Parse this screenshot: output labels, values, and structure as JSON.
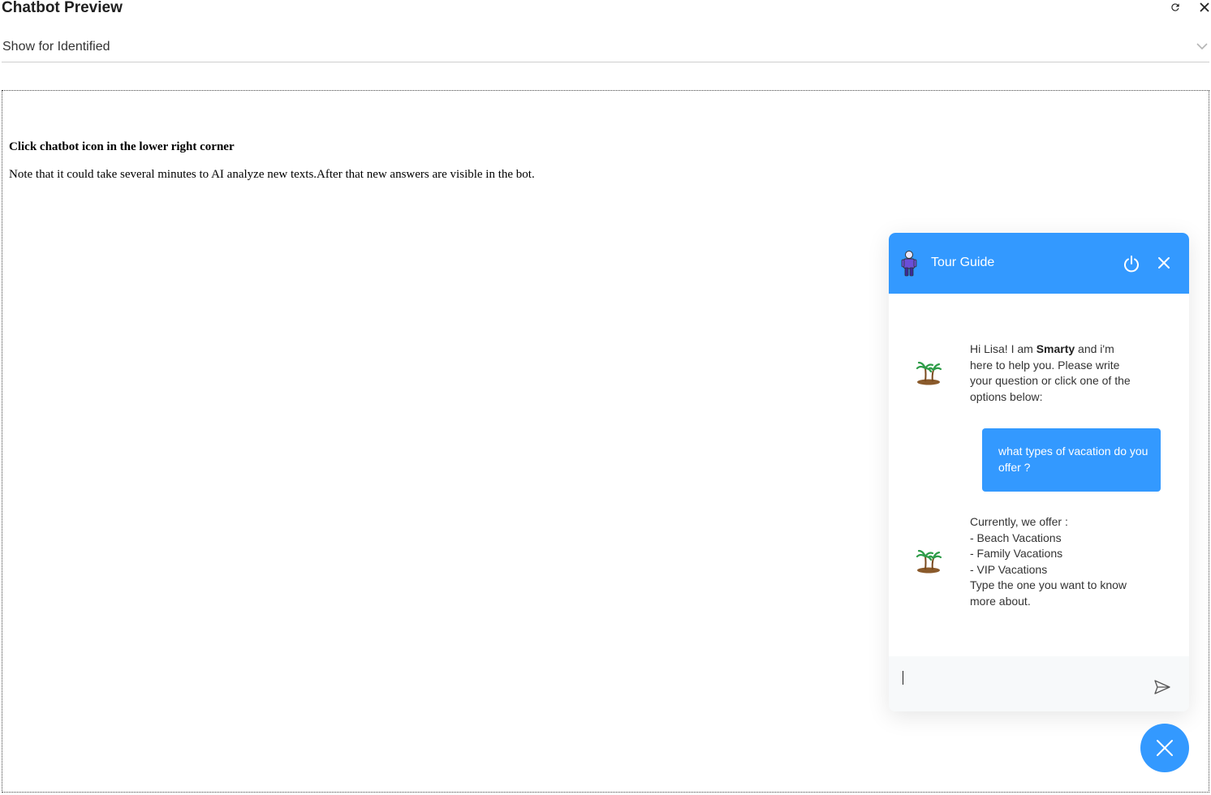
{
  "dialog": {
    "title": "Chatbot Preview",
    "refresh_icon": "refresh-icon",
    "close_icon": "close-icon"
  },
  "audience_select": {
    "value": "Show for Identified",
    "icon": "chevron-down-icon"
  },
  "preview": {
    "heading": "Click chatbot icon in the lower right corner",
    "note": "Note that it could take several minutes to AI analyze new texts.After that new answers are visible in the bot."
  },
  "chat": {
    "title": "Tour Guide",
    "accent_color": "#3399ff",
    "bot_avatar_icon": "person-icon",
    "message_avatar_icon": "palm-tree-island-icon",
    "messages": [
      {
        "from": "bot",
        "parts": [
          "Hi Lisa!  I am ",
          "Smarty",
          " and i'm here to help you. Please write your question or click one of the options below:"
        ]
      },
      {
        "from": "user",
        "text": "what types of vacation do you offer ?"
      },
      {
        "from": "bot",
        "lines": [
          "Currently, we offer :",
          "- Beach Vacations",
          "- Family Vacations",
          "- VIP Vacations",
          "Type the one you want to know more about."
        ]
      }
    ],
    "input": {
      "value": "",
      "placeholder": ""
    }
  }
}
